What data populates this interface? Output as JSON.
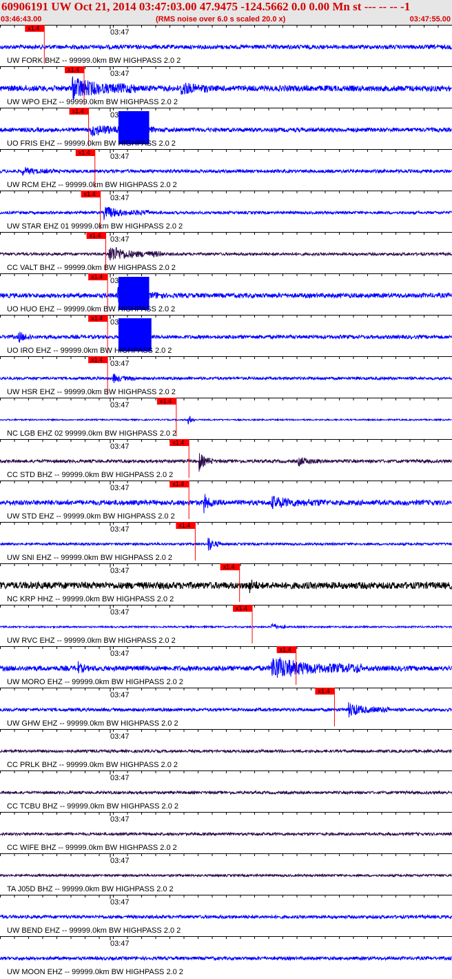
{
  "header": {
    "title": "60906191 UW Oct 21, 2014 03:47:03.00   47.9475 -124.5662  0.0 0.00 Mn st --- -- --  -1",
    "start_time": "03:46:43.00",
    "note": "(RMS noise over 6.0 s scaled 20.0 x)",
    "end_time": "03:47:55.00",
    "minute_label": "03:47",
    "pick_label": "x1.4"
  },
  "colors": {
    "title": "#d40000",
    "header_bg": "#e6e6e6",
    "pick": "#ff0000",
    "blue": "#0000ff",
    "purple": "#2a0a4a",
    "black": "#000000"
  },
  "traces": [
    {
      "label": "UW FORK BHZ -- 99999.0km BW  HIGHPASS  2.0  2",
      "color": "blue",
      "amp": 0.18,
      "pick": 0.098,
      "events": [],
      "clip": null
    },
    {
      "label": "UW WPO EHZ -- 99999.0km BW  HIGHPASS  2.0  2",
      "color": "blue",
      "amp": 0.25,
      "pick": 0.186,
      "events": [
        [
          0.16,
          0.3,
          0.95
        ],
        [
          0.4,
          0.46,
          0.6
        ]
      ],
      "clip": null
    },
    {
      "label": "UO FRIS EHZ -- 99999.0km BW  HIGHPASS  2.0  2",
      "color": "blue",
      "amp": 0.18,
      "pick": 0.196,
      "events": [
        [
          0.2,
          0.34,
          0.45
        ]
      ],
      "clip": [
        0.262,
        0.33
      ]
    },
    {
      "label": "UW RCM EHZ -- 99999.0km BW  HIGHPASS  2.0  2",
      "color": "blue",
      "amp": 0.14,
      "pick": 0.21,
      "events": [
        [
          0.05,
          0.12,
          0.3
        ]
      ],
      "clip": null
    },
    {
      "label": "UW STAR EHZ 01 99999.0km BW  HIGHPASS  2.0  2",
      "color": "blue",
      "amp": 0.12,
      "pick": 0.222,
      "events": [
        [
          0.23,
          0.33,
          0.55
        ]
      ],
      "clip": null
    },
    {
      "label": "CC VALT BHZ -- 99999.0km BW  HIGHPASS  2.0  2",
      "color": "purple",
      "amp": 0.12,
      "pick": 0.234,
      "events": [
        [
          0.24,
          0.36,
          0.75
        ]
      ],
      "clip": null
    },
    {
      "label": "UO HUO EHZ -- 99999.0km BW  HIGHPASS  2.0  2",
      "color": "blue",
      "amp": 0.2,
      "pick": 0.238,
      "events": [
        [
          0.26,
          0.36,
          0.6
        ]
      ],
      "clip": [
        0.262,
        0.33
      ]
    },
    {
      "label": "UO IRO EHZ -- 99999.0km BW  HIGHPASS  2.0  2",
      "color": "blue",
      "amp": 0.16,
      "pick": 0.238,
      "events": [
        [
          0.04,
          0.07,
          0.5
        ]
      ],
      "clip": [
        0.262,
        0.335
      ]
    },
    {
      "label": "UW HSR EHZ -- 99999.0km BW  HIGHPASS  2.0  2",
      "color": "blue",
      "amp": 0.12,
      "pick": 0.238,
      "events": [
        [
          0.25,
          0.3,
          0.35
        ]
      ],
      "clip": null
    },
    {
      "label": "NC LGB EHZ 02 99999.0km BW  HIGHPASS  2.0  2",
      "color": "blue",
      "amp": 0.06,
      "pick": 0.39,
      "events": [
        [
          0.415,
          0.43,
          0.7
        ]
      ],
      "clip": null
    },
    {
      "label": "CC STD BHZ -- 99999.0km BW  HIGHPASS  2.0  2",
      "color": "purple",
      "amp": 0.14,
      "pick": 0.418,
      "events": [
        [
          0.44,
          0.47,
          0.85
        ],
        [
          0.66,
          0.72,
          0.35
        ]
      ],
      "clip": null
    },
    {
      "label": "UW STD EHZ -- 99999.0km BW  HIGHPASS  2.0  2",
      "color": "blue",
      "amp": 0.22,
      "pick": 0.418,
      "events": [
        [
          0.45,
          0.47,
          1.0
        ],
        [
          0.6,
          0.72,
          0.45
        ]
      ],
      "clip": null
    },
    {
      "label": "UW SNI EHZ -- 99999.0km BW  HIGHPASS  2.0  2",
      "color": "blue",
      "amp": 0.1,
      "pick": 0.432,
      "events": [
        [
          0.46,
          0.49,
          0.7
        ]
      ],
      "clip": null
    },
    {
      "label": "NC KRP HHZ -- 99999.0km BW  HIGHPASS  2.0  2",
      "color": "black",
      "amp": 0.3,
      "pick": 0.53,
      "events": [
        [
          0.55,
          0.57,
          0.6
        ]
      ],
      "clip": null
    },
    {
      "label": "UW RVC EHZ -- 99999.0km BW  HIGHPASS  2.0  2",
      "color": "blue",
      "amp": 0.07,
      "pick": 0.558,
      "events": [
        [
          0.6,
          0.63,
          0.45
        ]
      ],
      "clip": null
    },
    {
      "label": "UW MORO EHZ -- 99999.0km BW  HIGHPASS  2.0  2",
      "color": "blue",
      "amp": 0.22,
      "pick": 0.655,
      "events": [
        [
          0.17,
          0.19,
          0.6
        ],
        [
          0.6,
          0.8,
          1.0
        ]
      ],
      "clip": null
    },
    {
      "label": "UW GHW EHZ -- 99999.0km BW  HIGHPASS  2.0  2",
      "color": "blue",
      "amp": 0.14,
      "pick": 0.74,
      "events": [
        [
          0.77,
          0.86,
          0.6
        ]
      ],
      "clip": null
    },
    {
      "label": "CC PRLK BHZ -- 99999.0km BW  HIGHPASS  2.0  2",
      "color": "purple",
      "amp": 0.12,
      "pick": null,
      "events": [],
      "clip": null
    },
    {
      "label": "CC TCBU BHZ -- 99999.0km BW  HIGHPASS  2.0  2",
      "color": "purple",
      "amp": 0.12,
      "pick": null,
      "events": [],
      "clip": null
    },
    {
      "label": "CC WIFE BHZ -- 99999.0km BW  HIGHPASS  2.0  2",
      "color": "purple",
      "amp": 0.12,
      "pick": null,
      "events": [],
      "clip": null
    },
    {
      "label": "TA J05D BHZ -- 99999.0km BW  HIGHPASS  2.0  2",
      "color": "purple",
      "amp": 0.1,
      "pick": null,
      "events": [],
      "clip": null
    },
    {
      "label": "UW BEND EHZ -- 99999.0km BW  HIGHPASS  2.0  2",
      "color": "blue",
      "amp": 0.14,
      "pick": null,
      "events": [],
      "clip": null
    },
    {
      "label": "UW MOON EHZ -- 99999.0km BW  HIGHPASS  2.0  2",
      "color": "blue",
      "amp": 0.14,
      "pick": null,
      "events": [],
      "clip": null
    }
  ]
}
